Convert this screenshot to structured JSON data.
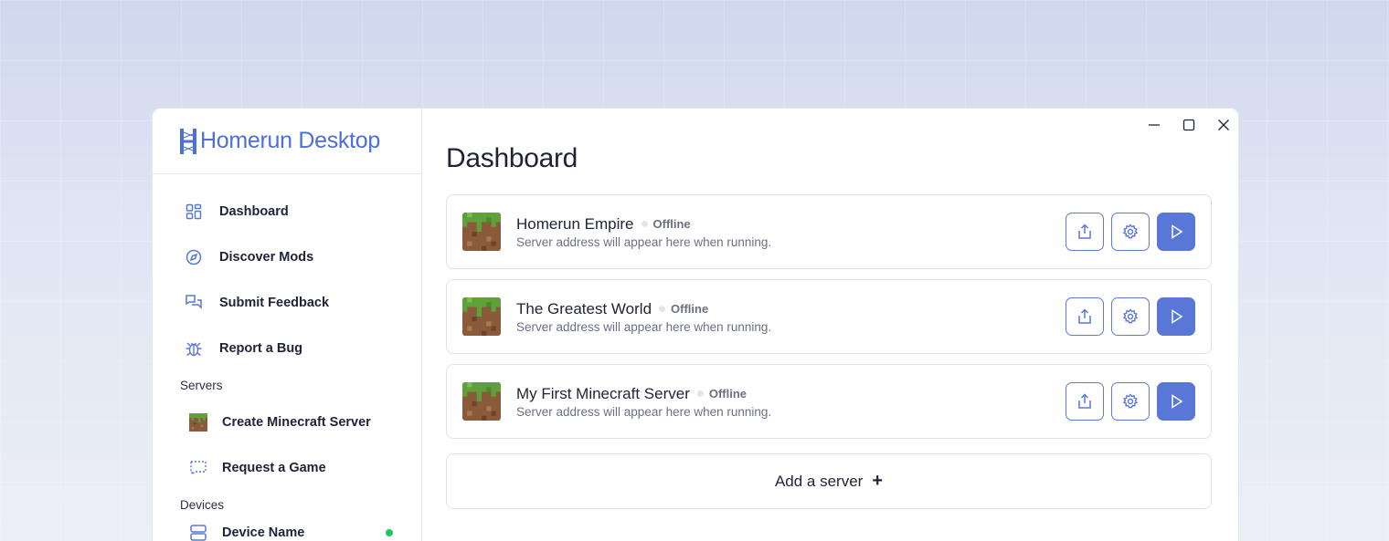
{
  "app": {
    "name": "Homerun Desktop"
  },
  "sidebar": {
    "nav": [
      {
        "label": "Dashboard",
        "icon": "dashboard-grid-icon"
      },
      {
        "label": "Discover Mods",
        "icon": "compass-icon"
      },
      {
        "label": "Submit Feedback",
        "icon": "chat-bubbles-icon"
      },
      {
        "label": "Report a Bug",
        "icon": "bug-icon"
      }
    ],
    "servers_section": "Servers",
    "servers": [
      {
        "label": "Create Minecraft Server",
        "icon": "minecraft-grass-block-icon"
      },
      {
        "label": "Request a Game",
        "icon": "dashed-chat-icon"
      }
    ],
    "devices_section": "Devices",
    "devices": [
      {
        "label": "Device Name",
        "icon": "server-rack-icon",
        "status_color": "#22c55e"
      }
    ]
  },
  "main": {
    "title": "Dashboard",
    "servers": [
      {
        "name": "Homerun Empire",
        "status": "Offline",
        "address": "Server address will appear here when running."
      },
      {
        "name": "The Greatest World",
        "status": "Offline",
        "address": "Server address will appear here when running."
      },
      {
        "name": "My First Minecraft Server",
        "status": "Offline",
        "address": "Server address will appear here when running."
      }
    ],
    "add_server_label": "Add a server",
    "add_server_icon": "+"
  },
  "colors": {
    "accent": "#5977d6",
    "online": "#22c55e",
    "text": "#1e2338"
  }
}
